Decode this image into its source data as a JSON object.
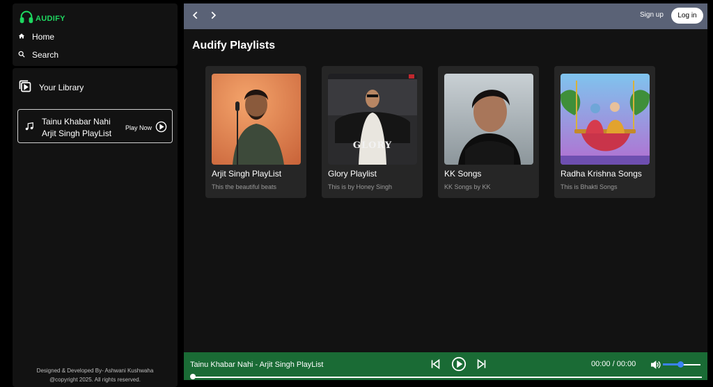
{
  "app": {
    "name": "AUDIFY",
    "brand_color": "#1ed760"
  },
  "nav": {
    "home": "Home",
    "search": "Search"
  },
  "library": {
    "title": "Your Library",
    "card": {
      "line1": "Tainu Khabar Nahi",
      "line2": "Arjit Singh PlayList",
      "action": "Play Now"
    }
  },
  "footer": {
    "line1": "Designed & Developed By- Ashwani Kushwaha",
    "line2": "@copyright 2025. All rights reserved."
  },
  "header": {
    "signup": "Sign up",
    "login": "Log in"
  },
  "main": {
    "title": "Audify Playlists",
    "playlists": [
      {
        "title": "Arjit Singh PlayList",
        "subtitle": "This the beautiful beats"
      },
      {
        "title": "Glory Playlist",
        "subtitle": "This is by Honey Singh",
        "cover_text": "GLORY"
      },
      {
        "title": "KK Songs",
        "subtitle": "KK Songs by KK"
      },
      {
        "title": "Radha Krishna Songs",
        "subtitle": "This is Bhakti Songs"
      }
    ]
  },
  "player": {
    "now_playing": "Tainu Khabar Nahi - Arjit Singh PlayList",
    "time": "00:00 / 00:00",
    "volume": 0.45,
    "progress": 0.0,
    "accent": "#3b82f6",
    "bar_color": "#1a6b35"
  },
  "icons": [
    "headphones-icon",
    "home-icon",
    "search-icon",
    "library-icon",
    "music-note-icon",
    "play-circle-icon",
    "chevron-left-icon",
    "chevron-right-icon",
    "skip-back-icon",
    "play-icon",
    "skip-forward-icon",
    "volume-icon"
  ]
}
